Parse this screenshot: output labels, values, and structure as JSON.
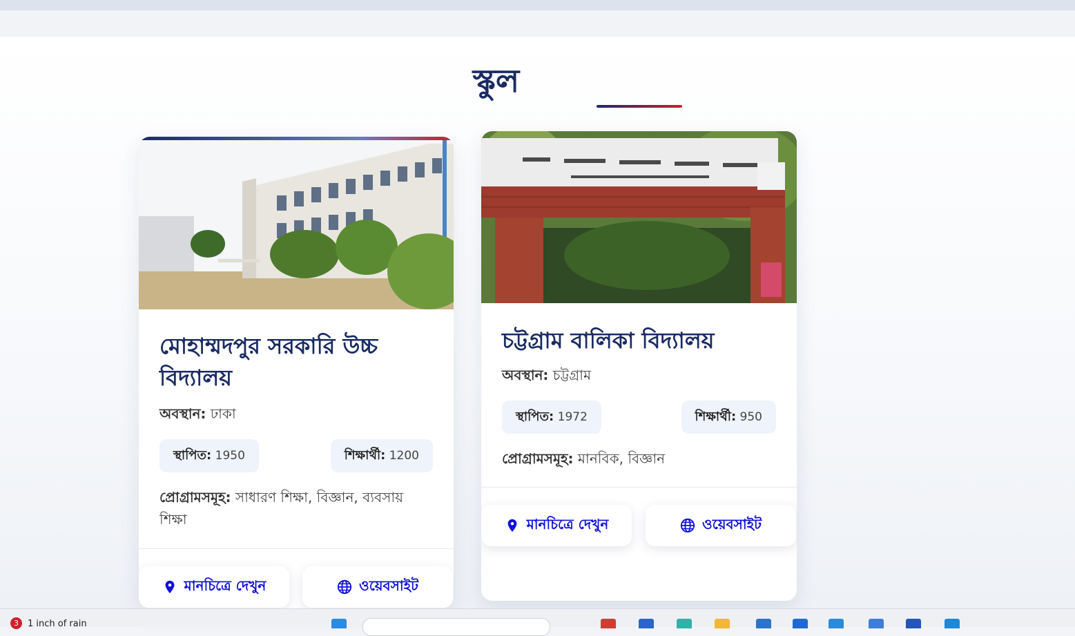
{
  "section": {
    "title": "স্কুল"
  },
  "labels": {
    "location": "অবস্থান:",
    "established": "স্থাপিত:",
    "students": "শিক্ষার্থী:",
    "programs": "প্রোগ্রামসমূহ:",
    "map_button": "মানচিত্রে দেখুন",
    "website_button": "ওয়েবসাইট"
  },
  "schools": [
    {
      "name": "মোহাম্মদপুর সরকারি উচ্চ বিদ্যালয়",
      "location": "ঢাকা",
      "established": "1950",
      "students": "1200",
      "programs": "সাধারণ শিক্ষা, বিজ্ঞান, ব্যবসায় শিক্ষা"
    },
    {
      "name": "চট্টগ্রাম বালিকা বিদ্যালয়",
      "location": "চট্টগ্রাম",
      "established": "1972",
      "students": "950",
      "programs": "মানবিক, বিজ্ঞান"
    }
  ],
  "taskbar": {
    "weather_badge": "3",
    "weather_text": "1 inch of rain"
  },
  "colors": {
    "primary": "#1a2b63",
    "accent": "#c8202f",
    "button_text": "#1010d8"
  },
  "icons": [
    "map-pin-icon",
    "globe-icon"
  ]
}
